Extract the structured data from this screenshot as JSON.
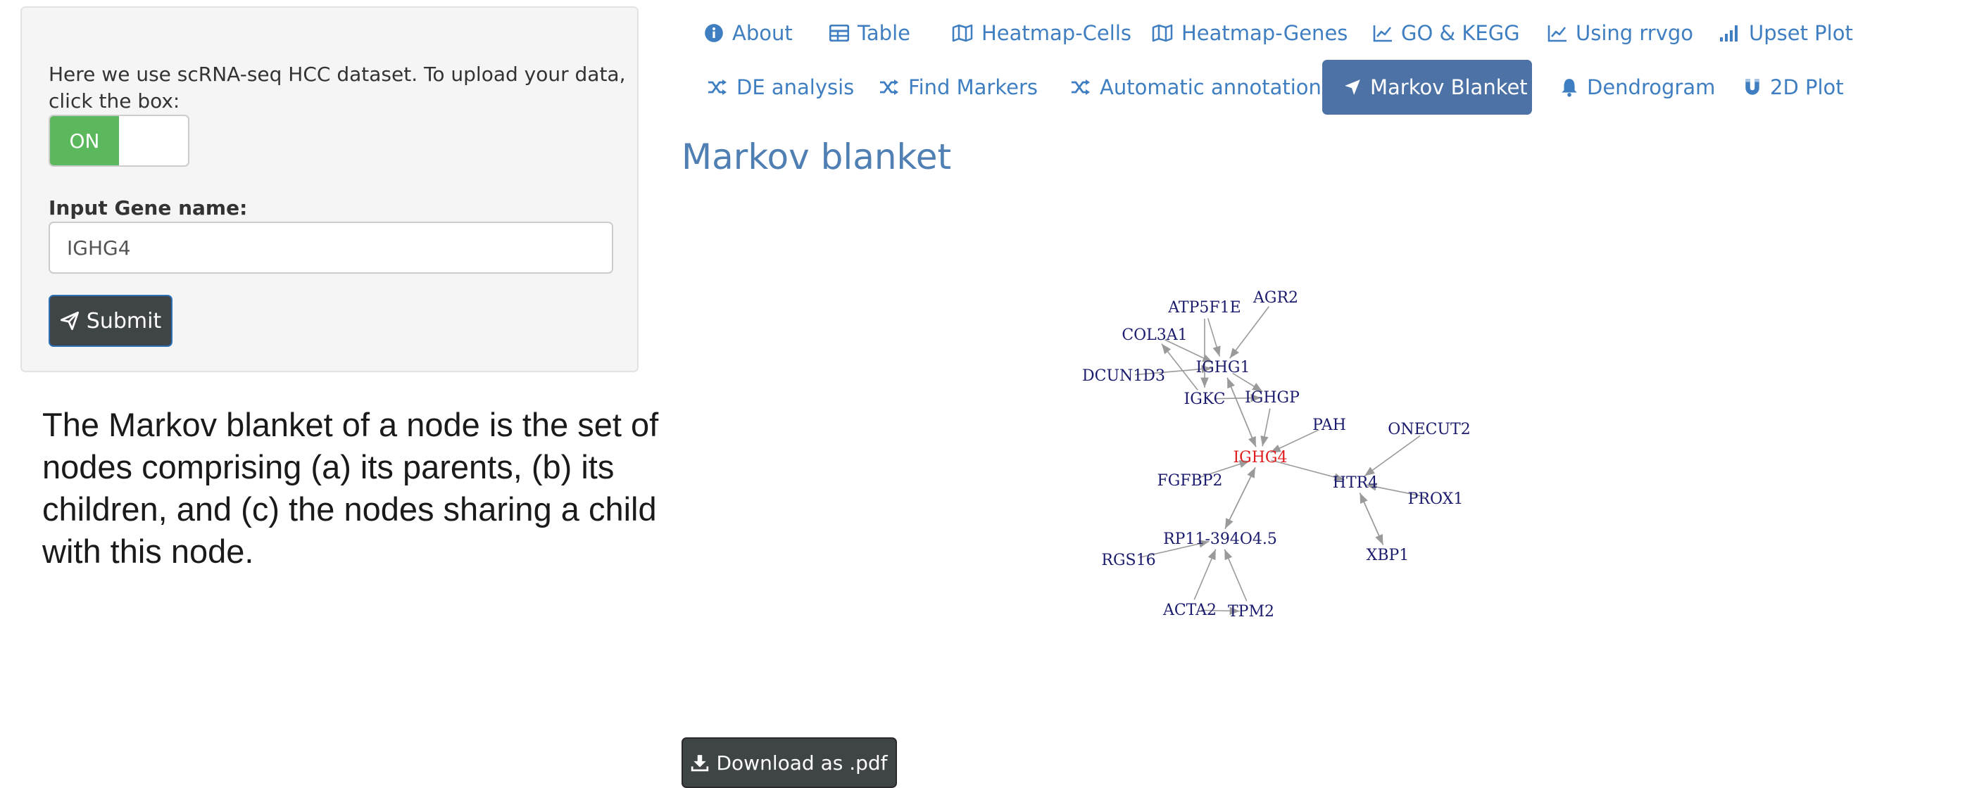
{
  "sidebar": {
    "intro_text": "Here we use scRNA-seq HCC dataset. To upload your data, click the box:",
    "toggle_on_label": "ON",
    "gene_label": "Input Gene name:",
    "gene_value": "IGHG4",
    "submit_label": "Submit"
  },
  "description": "The Markov blanket of a node is the set of nodes comprising (a) its parents, (b) its children, and (c) the nodes sharing a child with this node.",
  "tabs": [
    {
      "label": "About",
      "icon": "info-circle-icon"
    },
    {
      "label": "Table",
      "icon": "table-icon"
    },
    {
      "label": "Heatmap-Cells",
      "icon": "map-icon"
    },
    {
      "label": "Heatmap-Genes",
      "icon": "map-icon"
    },
    {
      "label": "GO & KEGG",
      "icon": "line-chart-icon"
    },
    {
      "label": "Using rrvgo",
      "icon": "line-chart-icon"
    },
    {
      "label": "Upset Plot",
      "icon": "signal-bars-icon"
    },
    {
      "label": "DE analysis",
      "icon": "shuffle-icon"
    },
    {
      "label": "Find Markers",
      "icon": "shuffle-icon"
    },
    {
      "label": "Automatic annotations",
      "icon": "shuffle-icon"
    },
    {
      "label": "Markov Blanket",
      "icon": "location-arrow-icon",
      "active": true
    },
    {
      "label": "Dendrogram",
      "icon": "bell-icon"
    },
    {
      "label": "2D Plot",
      "icon": "magnet-icon"
    }
  ],
  "main": {
    "title": "Markov blanket",
    "download_label": "Download as .pdf"
  },
  "graph": {
    "focus_node": "IGHG4",
    "nodes": [
      "AGR2",
      "ATP5F1E",
      "COL3A1",
      "IGHG1",
      "DCUN1D3",
      "IGKC",
      "IGHGP",
      "PAH",
      "ONECUT2",
      "IGHG4",
      "FGFBP2",
      "HTR4",
      "PROX1",
      "RP11-394O4.5",
      "XBP1",
      "RGS16",
      "ACTA2",
      "TPM2"
    ],
    "edges": [
      [
        "AGR2",
        "IGHG1"
      ],
      [
        "ATP5F1E",
        "IGHG1"
      ],
      [
        "ATP5F1E",
        "IGKC"
      ],
      [
        "COL3A1",
        "IGHG1"
      ],
      [
        "IGKC",
        "COL3A1"
      ],
      [
        "DCUN1D3",
        "IGHG1"
      ],
      [
        "IGHG1",
        "IGHGP"
      ],
      [
        "IGKC",
        "IGHGP"
      ],
      [
        "IGHGP",
        "IGHG4"
      ],
      [
        "IGHG1",
        "IGHG4"
      ],
      [
        "IGHG4",
        "IGHG1"
      ],
      [
        "PAH",
        "IGHG4"
      ],
      [
        "IGHG4",
        "HTR4"
      ],
      [
        "ONECUT2",
        "HTR4"
      ],
      [
        "PROX1",
        "HTR4"
      ],
      [
        "XBP1",
        "HTR4"
      ],
      [
        "HTR4",
        "XBP1"
      ],
      [
        "FGFBP2",
        "IGHG4"
      ],
      [
        "RP11-394O4.5",
        "IGHG4"
      ],
      [
        "IGHG4",
        "RP11-394O4.5"
      ],
      [
        "RGS16",
        "RP11-394O4.5"
      ],
      [
        "ACTA2",
        "RP11-394O4.5"
      ],
      [
        "TPM2",
        "RP11-394O4.5"
      ],
      [
        "ACTA2",
        "TPM2"
      ]
    ],
    "colors": {
      "node_text": "#1b1b6e",
      "focus_text": "#e01b1b",
      "edge": "#9a9a9a"
    }
  },
  "colors": {
    "accent": "#3f7fc1",
    "active_tab": "#4c72a6",
    "toggle_on": "#5cb85c",
    "title": "#4f7fb3"
  }
}
